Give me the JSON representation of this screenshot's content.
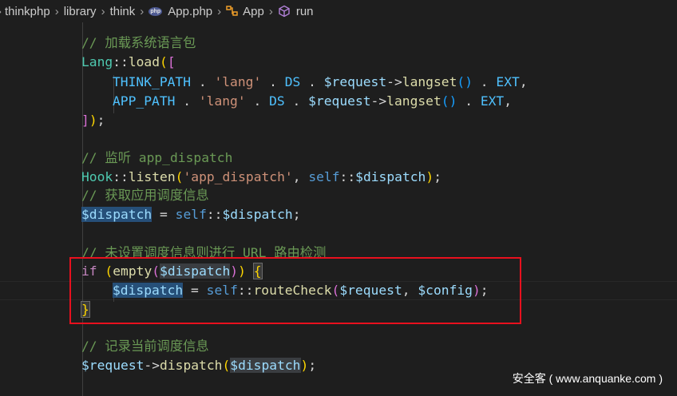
{
  "breadcrumb": {
    "items": [
      "thinkphp",
      "library",
      "think",
      "App.php",
      "App",
      "run"
    ],
    "php_badge": "php"
  },
  "code": {
    "lines": [
      {
        "tokens": [
          {
            "t": "// 加载系统语言包",
            "c": "com"
          }
        ]
      },
      {
        "tokens": [
          {
            "t": "Lang",
            "c": "cls"
          },
          {
            "t": "::",
            "c": "op"
          },
          {
            "t": "load",
            "c": "fn"
          },
          {
            "t": "(",
            "c": "br1"
          },
          {
            "t": "[",
            "c": "br2"
          }
        ]
      },
      {
        "tokens": [
          {
            "t": "THINK_PATH",
            "c": "const"
          },
          {
            "t": " . ",
            "c": "op"
          },
          {
            "t": "'lang'",
            "c": "str"
          },
          {
            "t": " . ",
            "c": "op"
          },
          {
            "t": "DS",
            "c": "const"
          },
          {
            "t": " . ",
            "c": "op"
          },
          {
            "t": "$request",
            "c": "var"
          },
          {
            "t": "->",
            "c": "op"
          },
          {
            "t": "langset",
            "c": "fn"
          },
          {
            "t": "()",
            "c": "br3"
          },
          {
            "t": " . ",
            "c": "op"
          },
          {
            "t": "EXT",
            "c": "const"
          },
          {
            "t": ",",
            "c": "op"
          }
        ]
      },
      {
        "tokens": [
          {
            "t": "APP_PATH",
            "c": "const"
          },
          {
            "t": " . ",
            "c": "op"
          },
          {
            "t": "'lang'",
            "c": "str"
          },
          {
            "t": " . ",
            "c": "op"
          },
          {
            "t": "DS",
            "c": "const"
          },
          {
            "t": " . ",
            "c": "op"
          },
          {
            "t": "$request",
            "c": "var"
          },
          {
            "t": "->",
            "c": "op"
          },
          {
            "t": "langset",
            "c": "fn"
          },
          {
            "t": "()",
            "c": "br3"
          },
          {
            "t": " . ",
            "c": "op"
          },
          {
            "t": "EXT",
            "c": "const"
          },
          {
            "t": ",",
            "c": "op"
          }
        ]
      },
      {
        "tokens": [
          {
            "t": "]",
            "c": "br2"
          },
          {
            "t": ")",
            "c": "br1"
          },
          {
            "t": ";",
            "c": "op"
          }
        ]
      },
      {
        "tokens": []
      },
      {
        "tokens": [
          {
            "t": "// 监听 app_dispatch",
            "c": "com"
          }
        ]
      },
      {
        "tokens": [
          {
            "t": "Hook",
            "c": "cls"
          },
          {
            "t": "::",
            "c": "op"
          },
          {
            "t": "listen",
            "c": "fn"
          },
          {
            "t": "(",
            "c": "br1"
          },
          {
            "t": "'app_dispatch'",
            "c": "str"
          },
          {
            "t": ", ",
            "c": "op"
          },
          {
            "t": "self",
            "c": "kw"
          },
          {
            "t": "::",
            "c": "op"
          },
          {
            "t": "$dispatch",
            "c": "var"
          },
          {
            "t": ")",
            "c": "br1"
          },
          {
            "t": ";",
            "c": "op"
          }
        ]
      },
      {
        "tokens": [
          {
            "t": "// 获取应用调度信息",
            "c": "com"
          }
        ]
      },
      {
        "tokens": [
          {
            "t": "$dispatch",
            "c": "var",
            "h": "hl"
          },
          {
            "t": " = ",
            "c": "op"
          },
          {
            "t": "self",
            "c": "kw"
          },
          {
            "t": "::",
            "c": "op"
          },
          {
            "t": "$dispatch",
            "c": "var"
          },
          {
            "t": ";",
            "c": "op"
          }
        ]
      },
      {
        "tokens": []
      },
      {
        "tokens": [
          {
            "t": "// 未设置调度信息则进行 URL 路由检测",
            "c": "com"
          }
        ]
      },
      {
        "tokens": [
          {
            "t": "if",
            "c": "ctl"
          },
          {
            "t": " ",
            "c": "op"
          },
          {
            "t": "(",
            "c": "br1"
          },
          {
            "t": "empty",
            "c": "fn"
          },
          {
            "t": "(",
            "c": "br2"
          },
          {
            "t": "$dispatch",
            "c": "var",
            "h": "hl-soft"
          },
          {
            "t": ")",
            "c": "br2"
          },
          {
            "t": ")",
            "c": "br1"
          },
          {
            "t": " ",
            "c": "op"
          },
          {
            "t": "{",
            "c": "br1",
            "h": "hl-brk"
          }
        ]
      },
      {
        "tokens": [
          {
            "t": "$dispatch",
            "c": "var",
            "h": "hl"
          },
          {
            "t": " = ",
            "c": "op"
          },
          {
            "t": "self",
            "c": "kw"
          },
          {
            "t": "::",
            "c": "op"
          },
          {
            "t": "routeCheck",
            "c": "fn"
          },
          {
            "t": "(",
            "c": "br2"
          },
          {
            "t": "$request",
            "c": "var"
          },
          {
            "t": ", ",
            "c": "op"
          },
          {
            "t": "$config",
            "c": "var"
          },
          {
            "t": ")",
            "c": "br2"
          },
          {
            "t": ";",
            "c": "op"
          }
        ]
      },
      {
        "tokens": [
          {
            "t": "}",
            "c": "br1",
            "h": "hl-brk"
          }
        ]
      },
      {
        "tokens": []
      },
      {
        "tokens": [
          {
            "t": "// 记录当前调度信息",
            "c": "com"
          }
        ]
      },
      {
        "tokens": [
          {
            "t": "$request",
            "c": "var"
          },
          {
            "t": "->",
            "c": "op"
          },
          {
            "t": "dispatch",
            "c": "fn"
          },
          {
            "t": "(",
            "c": "br1"
          },
          {
            "t": "$dispatch",
            "c": "var",
            "h": "hl-soft"
          },
          {
            "t": ")",
            "c": "br1"
          },
          {
            "t": ";",
            "c": "op"
          }
        ]
      }
    ]
  },
  "watermark": "安全客 ( www.anquanke.com )",
  "colors": {
    "background": "#1e1e1e",
    "highlight_box": "#e8101e",
    "comment": "#6a9955",
    "string": "#ce9178",
    "variable": "#9cdcfe"
  }
}
